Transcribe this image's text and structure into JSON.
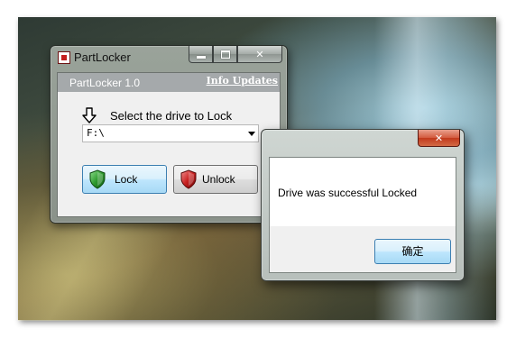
{
  "main_window": {
    "title": "PartLocker",
    "caption_buttons": {
      "minimize": "minimize-icon",
      "maximize": "maximize-icon",
      "close": "✕"
    },
    "header": {
      "title": "PartLocker 1.0",
      "link": "Info Updates"
    },
    "select_label": "Select the drive to Lock",
    "drive_combo": {
      "value": "F:\\"
    },
    "buttons": {
      "lock": "Lock",
      "unlock": "Unlock"
    },
    "icons": {
      "arrow": "down-arrow-icon",
      "lock_shield": "green-shield-icon",
      "unlock_shield": "red-shield-icon"
    },
    "colors": {
      "lock_shield": "#2e9a2e",
      "unlock_shield": "#c82020"
    }
  },
  "message_box": {
    "close": "✕",
    "message": "Drive was successful Locked",
    "ok_button": "确定"
  }
}
